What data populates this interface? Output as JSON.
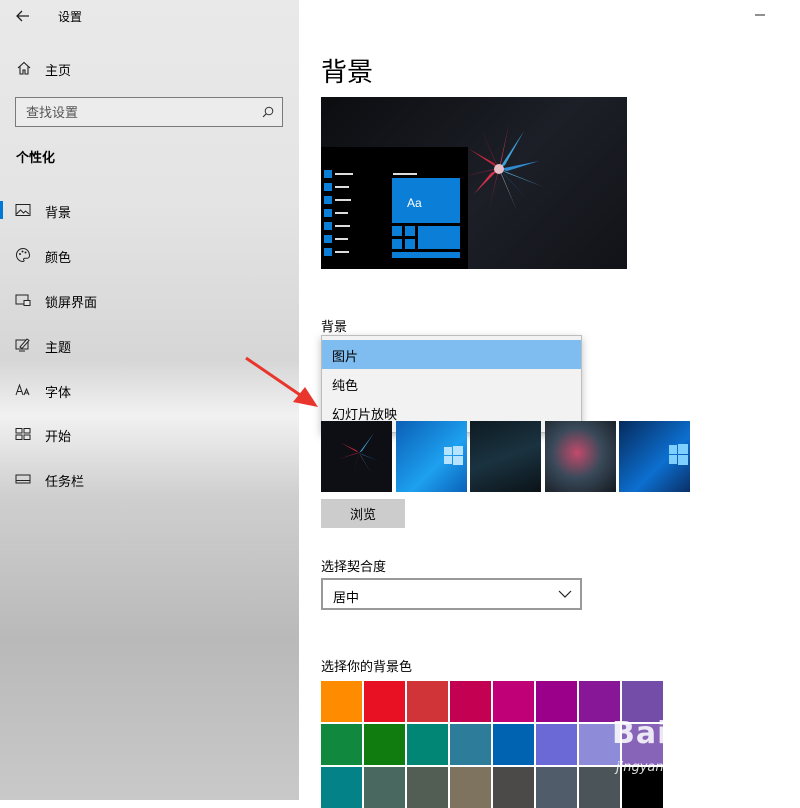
{
  "window": {
    "title": "设置",
    "minimize_label": "–"
  },
  "sidebar": {
    "home_label": "主页",
    "search_placeholder": "查找设置",
    "section": "个性化",
    "items": [
      {
        "label": "背景",
        "icon": "picture-icon",
        "active": true
      },
      {
        "label": "颜色",
        "icon": "palette-icon",
        "active": false
      },
      {
        "label": "锁屏界面",
        "icon": "lockscreen-icon",
        "active": false
      },
      {
        "label": "主题",
        "icon": "theme-brush-icon",
        "active": false
      },
      {
        "label": "字体",
        "icon": "font-icon",
        "active": false
      },
      {
        "label": "开始",
        "icon": "start-grid-icon",
        "active": false
      },
      {
        "label": "任务栏",
        "icon": "taskbar-icon",
        "active": false
      }
    ]
  },
  "main": {
    "page_title": "背景",
    "preview": {
      "tile_text": "Aa"
    },
    "background_label": "背景",
    "background_options": [
      "图片",
      "纯色",
      "幻灯片放映"
    ],
    "background_selected": "图片",
    "choose_picture_thumbs": [
      "wallpaper-crystal",
      "wallpaper-windows-blue",
      "wallpaper-dark-waves",
      "wallpaper-crystal-smoke",
      "wallpaper-windows-light"
    ],
    "browse_label": "浏览",
    "fit_label": "选择契合度",
    "fit_value": "居中",
    "color_label": "选择你的背景色",
    "colors": [
      "#ff8c00",
      "#e81123",
      "#d13438",
      "#c30052",
      "#bf0077",
      "#9a0089",
      "#881798",
      "#744da9",
      "#10893e",
      "#107c10",
      "#018574",
      "#2d7d9a",
      "#0063b1",
      "#6b69d6",
      "#8e8cd8",
      "#8764b8",
      "#038387",
      "#486860",
      "#525e54",
      "#7e735f",
      "#4c4a48",
      "#515c6b",
      "#4a5459",
      "#000000"
    ]
  },
  "annotation": {
    "arrow_color": "#e8362c"
  },
  "watermark": {
    "main": "Bai 经验",
    "sub": "jingyan.baidu.com"
  }
}
